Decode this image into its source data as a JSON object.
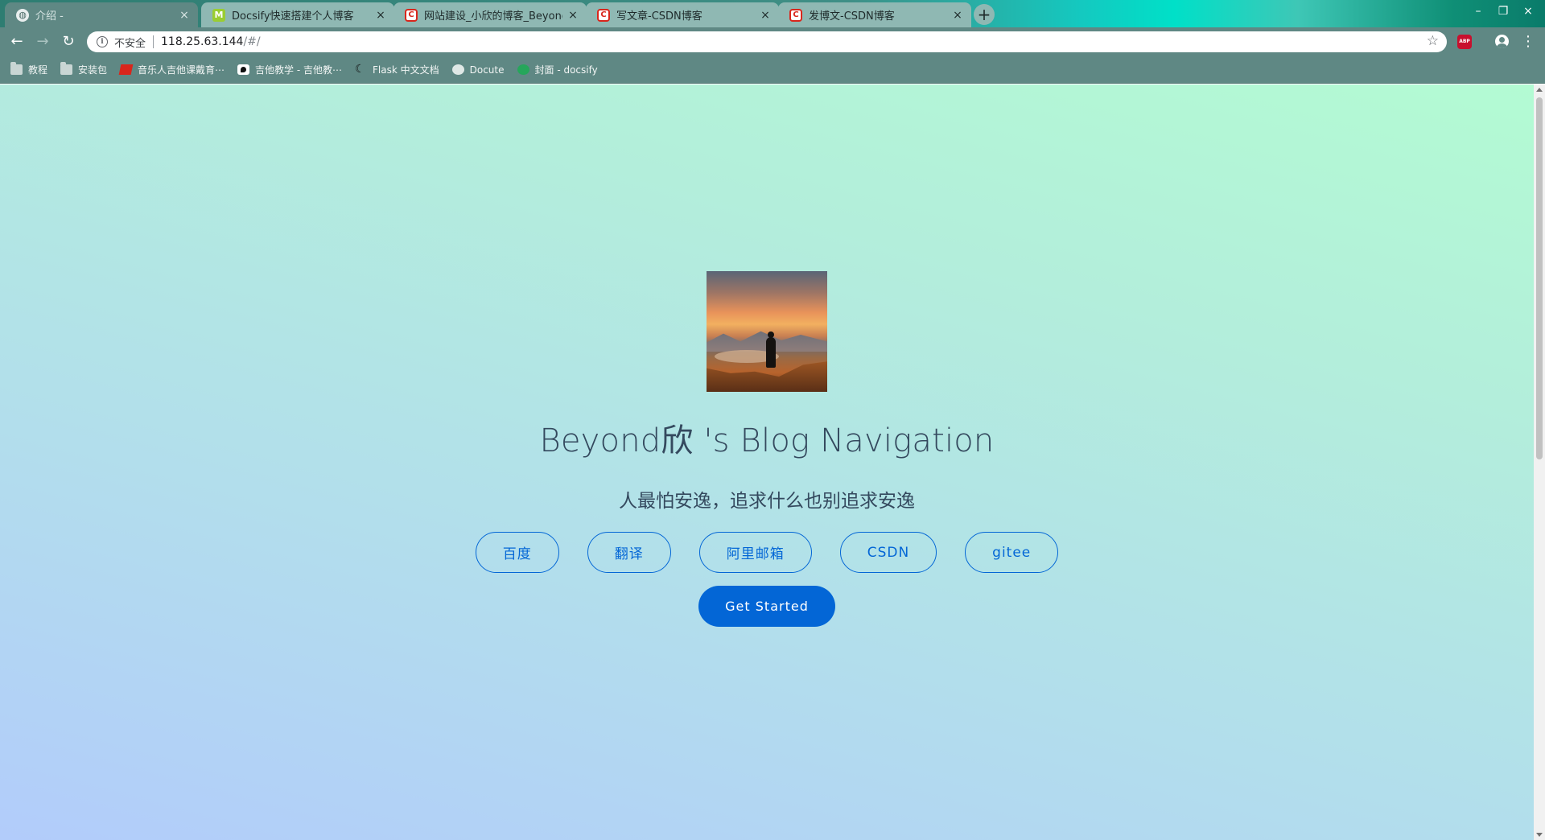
{
  "browser": {
    "tabs": [
      {
        "title": "介绍 -",
        "favicon": "globe-icon",
        "active": true
      },
      {
        "title": "Docsify快速搭建个人博客",
        "favicon": "m-logo-icon",
        "active": false
      },
      {
        "title": "网站建设_小欣的博客_Beyond欣",
        "favicon": "csdn-icon",
        "active": false
      },
      {
        "title": "写文章-CSDN博客",
        "favicon": "csdn-icon",
        "active": false
      },
      {
        "title": "发博文-CSDN博客",
        "favicon": "csdn-icon",
        "active": false
      }
    ],
    "close_glyph": "×",
    "new_tab_glyph": "+",
    "window_controls": {
      "minimize": "–",
      "restore": "❐",
      "close": "×"
    },
    "nav": {
      "back": "←",
      "forward": "→",
      "reload": "↻"
    },
    "address": {
      "security_label": "不安全",
      "host": "118.25.63.144",
      "path": "/#/",
      "star_glyph": "☆"
    },
    "extension_label": "ABP",
    "menu_glyph": "⋮",
    "bookmarks": [
      {
        "label": "教程",
        "icon": "folder-icon"
      },
      {
        "label": "安装包",
        "icon": "folder-icon"
      },
      {
        "label": "音乐人吉他课戴育⋯",
        "icon": "music-site-icon"
      },
      {
        "label": "吉他教学 - 吉他教⋯",
        "icon": "guitar-site-icon"
      },
      {
        "label": "Flask 中文文档",
        "icon": "flask-icon"
      },
      {
        "label": "Docute",
        "icon": "globe-icon"
      },
      {
        "label": "封面 - docsify",
        "icon": "frog-icon"
      }
    ]
  },
  "page": {
    "title": "Beyond欣 's Blog Navigation",
    "tagline": "人最怕安逸，追求什么也别追求安逸",
    "links": [
      {
        "label": "百度"
      },
      {
        "label": "翻译"
      },
      {
        "label": "阿里邮箱"
      },
      {
        "label": "CSDN"
      },
      {
        "label": "gitee"
      }
    ],
    "cta_label": "Get Started",
    "colors": {
      "accent": "#0366d6",
      "text": "#34495e",
      "gradient_start": "#b2ccfb",
      "gradient_end": "#b3fbd3"
    }
  }
}
